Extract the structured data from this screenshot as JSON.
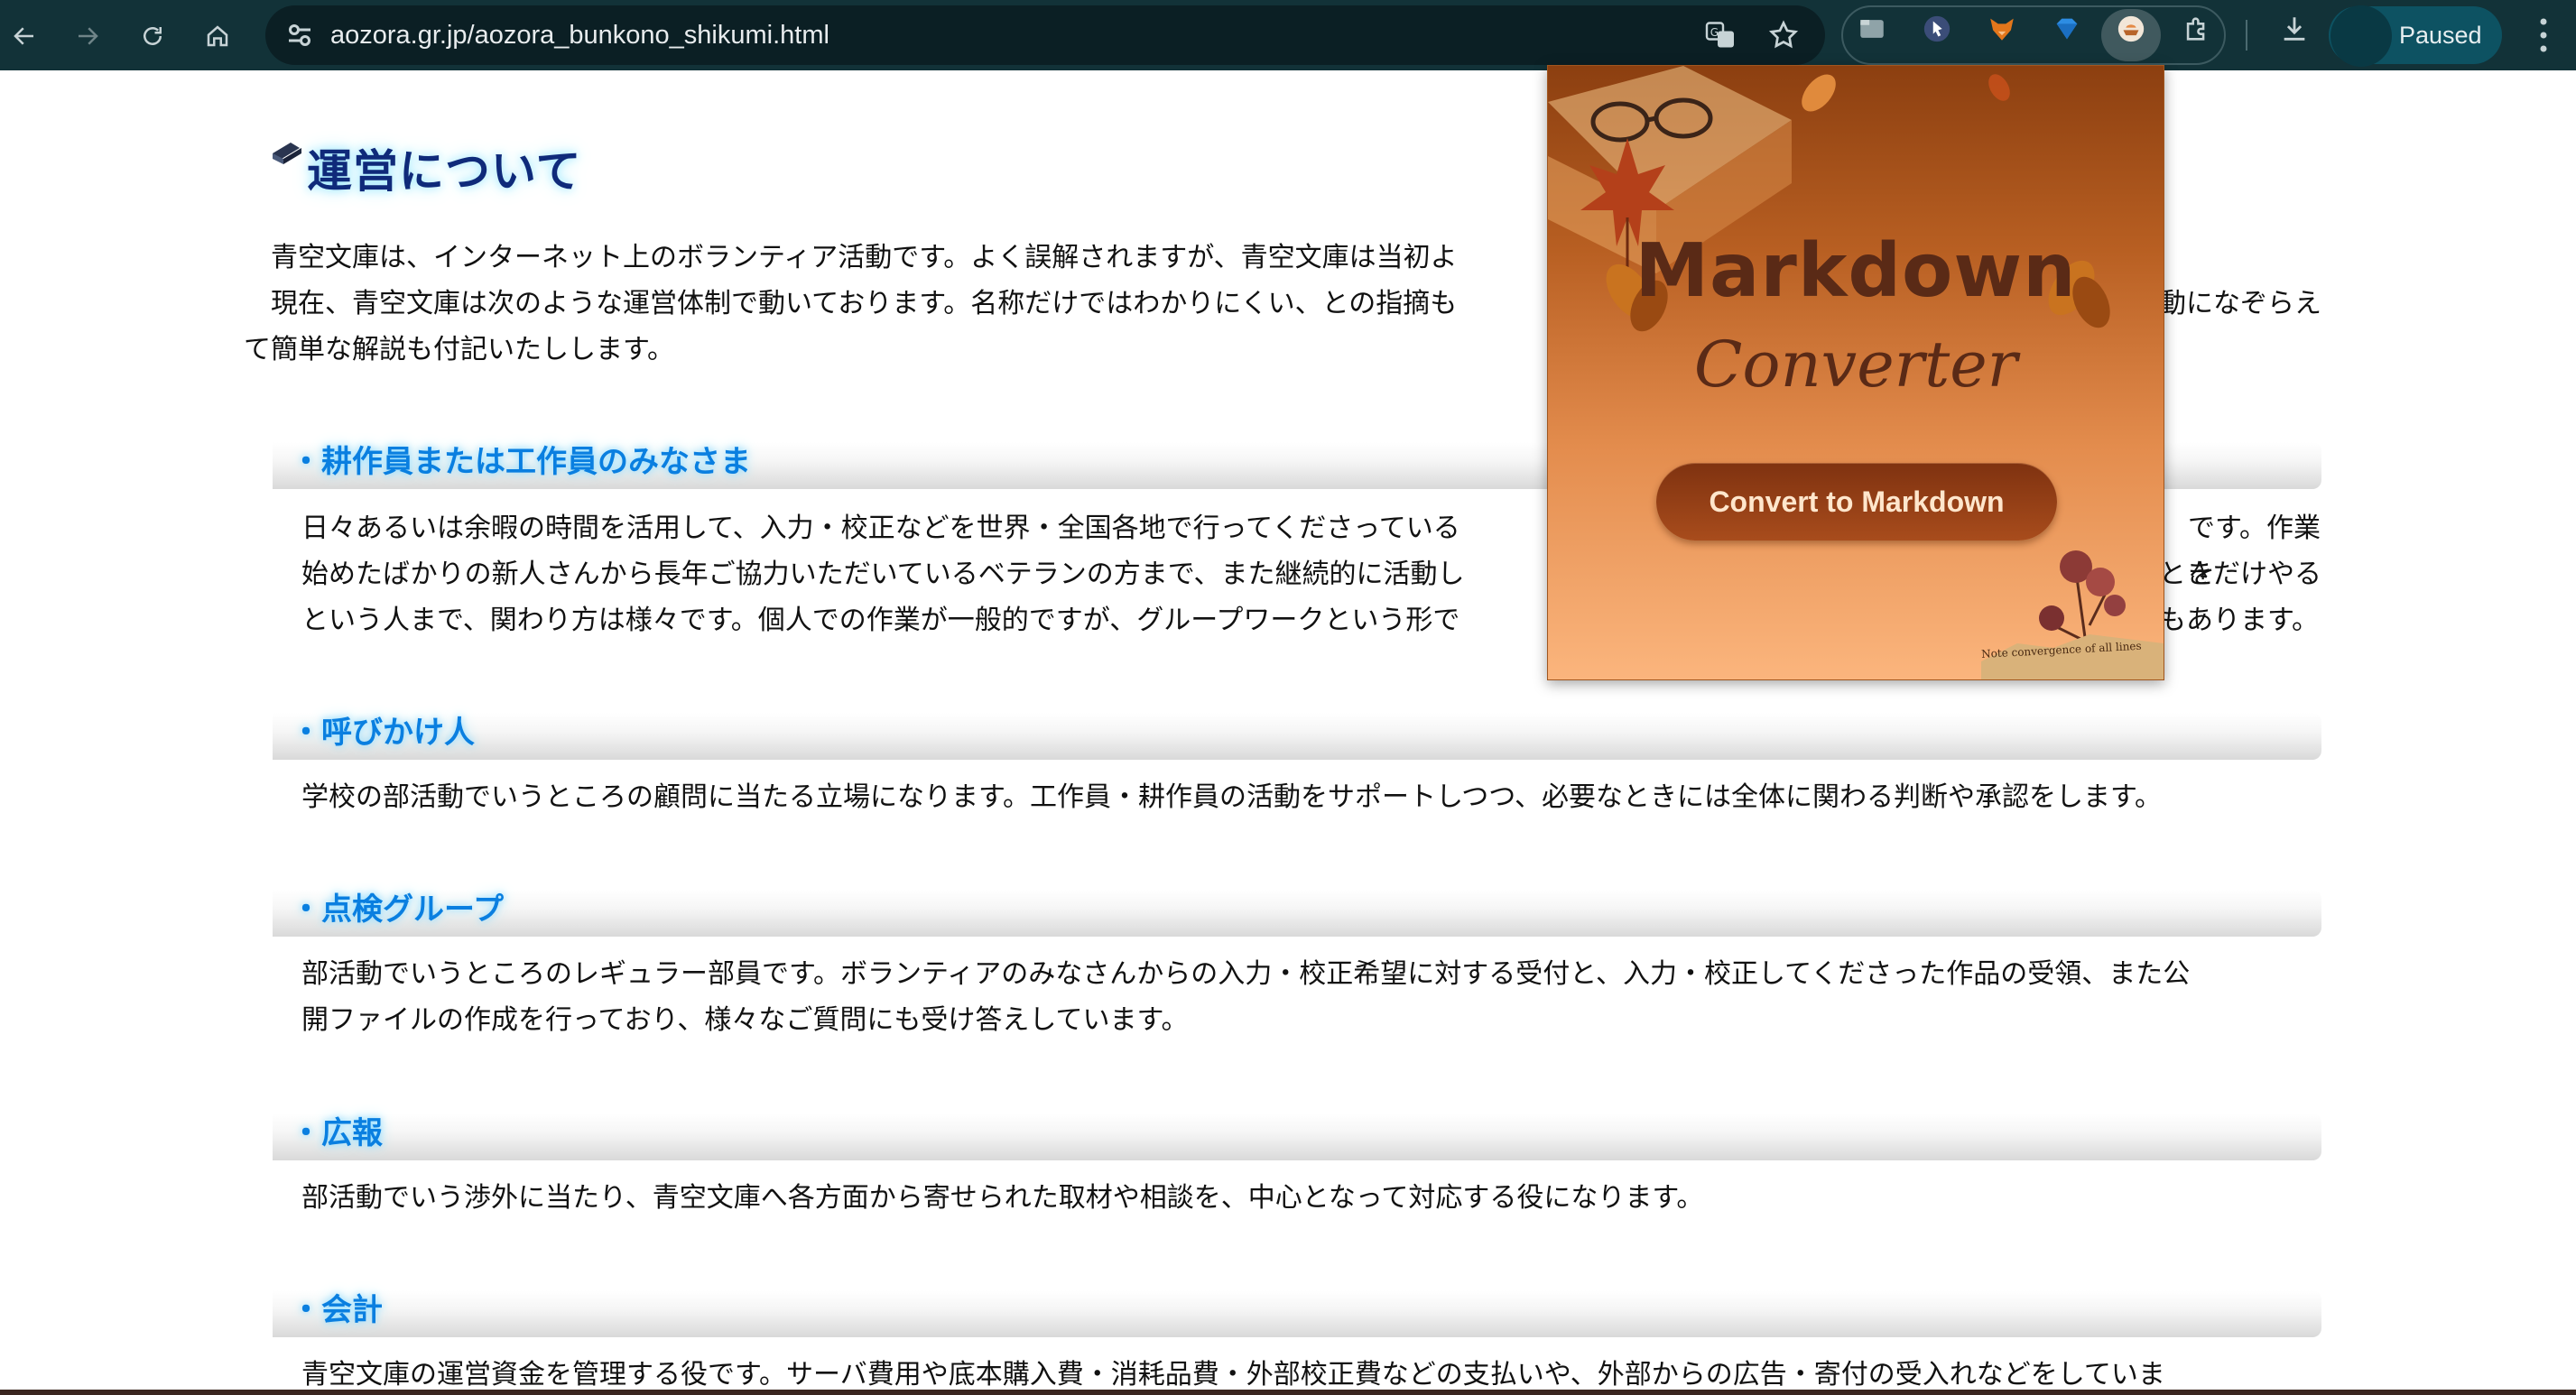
{
  "browser": {
    "url": "aozora.gr.jp/aozora_bunkono_shikumi.html",
    "profile_label": "Paused"
  },
  "page": {
    "title": "運営について",
    "intro": [
      "　青空文庫は、インターネット上のボランティア活動です。よく誤解されますが、青空文庫は当初よ",
      "　現在、青空文庫は次のような運営体制で動いております。名称だけではわかりにくい、との指摘も",
      "動になぞらえ",
      "て簡単な解説も付記いたしします。"
    ],
    "sections": [
      {
        "heading": "・耕作員または工作員のみなさま",
        "lines": [
          "日々あるいは余暇の時間を活用して、入力・校正などを世界・全国各地で行ってくださっている",
          "です。作業を",
          "始めたばかりの新人さんから長年ご協力いただいているベテランの方まで、また継続的に活動し",
          "ときだけやる",
          "という人まで、関わり方は様々です。個人での作業が一般的ですが、グループワークという形で",
          "もあります。"
        ]
      },
      {
        "heading": "・呼びかけ人",
        "lines": [
          "学校の部活動でいうところの顧問に当たる立場になります。工作員・耕作員の活動をサポートしつつ、必要なときには全体に関わる判断や承認をします。"
        ]
      },
      {
        "heading": "・点検グループ",
        "lines": [
          "部活動でいうところのレギュラー部員です。ボランティアのみなさんからの入力・校正希望に対する受付と、入力・校正してくださった作品の受領、また公",
          "開ファイルの作成を行っており、様々なご質問にも受け答えしています。"
        ]
      },
      {
        "heading": "・広報",
        "lines": [
          "部活動でいう渉外に当たり、青空文庫へ各方面から寄せられた取材や相談を、中心となって対応する役になります。"
        ]
      },
      {
        "heading": "・会計",
        "lines": [
          "青空文庫の運営資金を管理する役です。サーバ費用や底本購入費・消耗品費・外部校正費などの支払いや、外部からの広告・寄付の受入れなどをしていま"
        ]
      }
    ]
  },
  "popup": {
    "title": "Markdown",
    "subtitle": "Converter",
    "button_label": "Convert to Markdown",
    "note_text": "Note convergence of all lines"
  },
  "colors": {
    "chrome_bg": "#123238",
    "heading_blue": "#0a7fe0",
    "title_navy": "#0f2a7a",
    "popup_button": "#8c3a14"
  }
}
